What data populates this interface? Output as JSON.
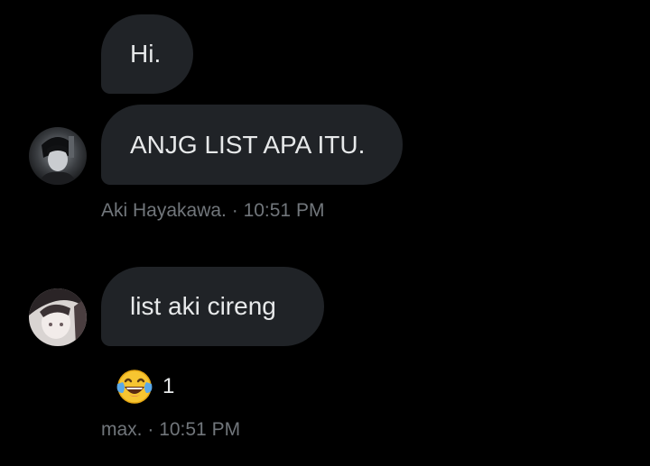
{
  "messages": [
    {
      "text": "Hi."
    },
    {
      "text": "ANJG LIST APA ITU."
    },
    {
      "text": "list aki cireng"
    }
  ],
  "meta": [
    {
      "sender": "Aki Hayakawa.",
      "separator": " · ",
      "time": "10:51 PM"
    },
    {
      "sender": "max.",
      "separator": " · ",
      "time": "10:51 PM"
    }
  ],
  "reaction": {
    "emoji": "face-with-tears-of-joy-icon",
    "count": "1"
  },
  "colors": {
    "background": "#000000",
    "bubble": "#202327",
    "text": "#e7e9ea",
    "meta": "#71767b"
  }
}
